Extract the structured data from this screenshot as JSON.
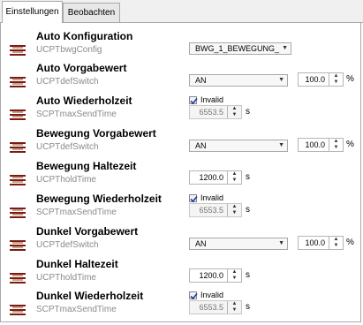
{
  "tabs": [
    {
      "label": "Einstellungen",
      "active": true
    },
    {
      "label": "Beobachten",
      "active": false
    }
  ],
  "properties": [
    {
      "title": "Auto Konfiguration",
      "sub": "UCPTbwgConfig",
      "control": "combo",
      "combo": "BWG_1_BEWEGUNG_"
    },
    {
      "title": "Auto Vorgabewert",
      "sub": "UCPTdefSwitch",
      "control": "combo-num",
      "combo": "AN",
      "value": "100.0",
      "unit": "%"
    },
    {
      "title": "Auto Wiederholzeit",
      "sub": "SCPTmaxSendTime",
      "control": "check-num",
      "check_label": "Invalid",
      "checked": true,
      "value": "6553.5",
      "unit": "s"
    },
    {
      "title": "Bewegung Vorgabewert",
      "sub": "UCPTdefSwitch",
      "control": "combo-num",
      "combo": "AN",
      "value": "100.0",
      "unit": "%"
    },
    {
      "title": "Bewegung Haltezeit",
      "sub": "UCPTholdTime",
      "control": "num",
      "value": "1200.0",
      "unit": "s"
    },
    {
      "title": "Bewegung Wiederholzeit",
      "sub": "SCPTmaxSendTime",
      "control": "check-num",
      "check_label": "Invalid",
      "checked": true,
      "value": "6553.5",
      "unit": "s"
    },
    {
      "title": "Dunkel Vorgabewert",
      "sub": "UCPTdefSwitch",
      "control": "combo-num",
      "combo": "AN",
      "value": "100.0",
      "unit": "%"
    },
    {
      "title": "Dunkel Haltezeit",
      "sub": "UCPTholdTime",
      "control": "num",
      "value": "1200.0",
      "unit": "s"
    },
    {
      "title": "Dunkel Wiederholzeit",
      "sub": "SCPTmaxSendTime",
      "control": "check-num",
      "check_label": "Invalid",
      "checked": true,
      "value": "6553.5",
      "unit": "s"
    }
  ],
  "colors": {
    "icon_dark": "#7a1c10",
    "icon_light": "#c9a08f",
    "sub_text": "#8a8a8a"
  },
  "icons": {
    "property": "property-icon",
    "dropdown": "chevron-down-icon",
    "spin_up": "spin-up-icon",
    "spin_down": "spin-down-icon",
    "check": "checkmark-icon"
  }
}
